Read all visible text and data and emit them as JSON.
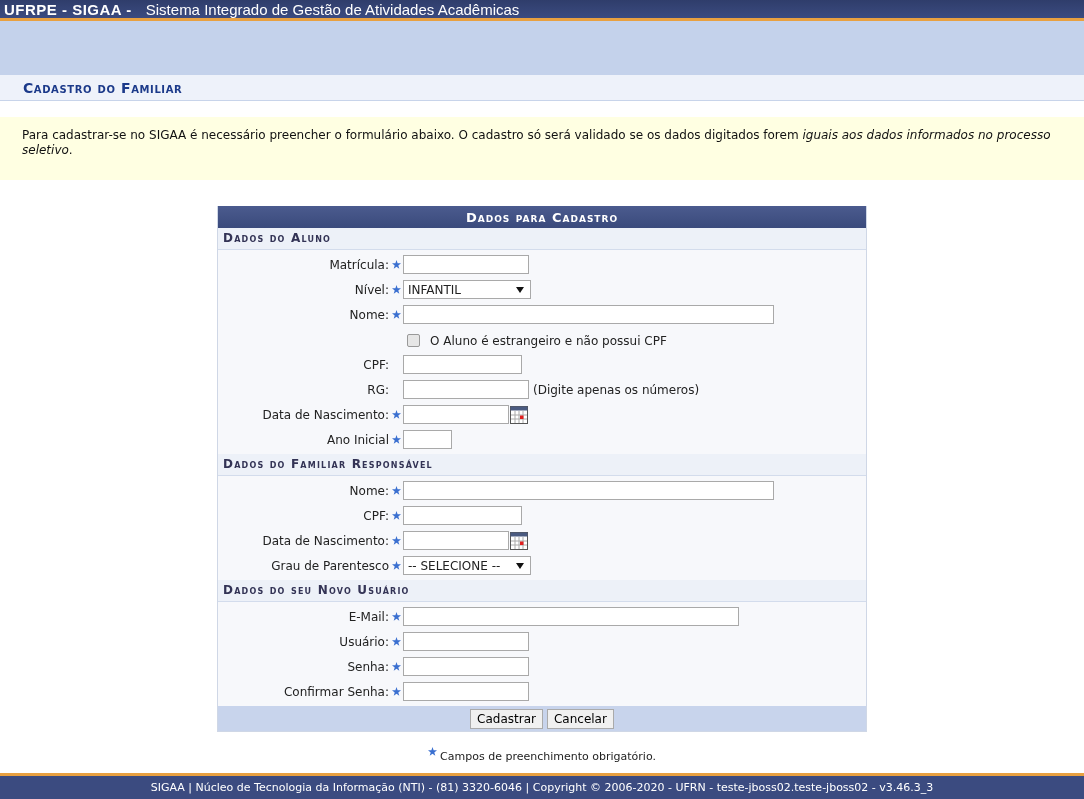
{
  "header": {
    "brand": "UFRPE - SIGAA -",
    "system_name": "Sistema Integrado de Gestão de Atividades Acadêmicas"
  },
  "page_title": "Cadastro do Familiar",
  "notice": "Para cadastrar-se no SIGAA é necessário preencher o formulário abaixo. O cadastro só será validado se os dados digitados forem *iguais aos dados informados no processo seletivo*.",
  "form": {
    "title": "Dados para Cadastro",
    "sections": [
      {
        "title": "Dados do Aluno",
        "fields": [
          {
            "kind": "medium",
            "label": "Matrícula:",
            "required": true
          },
          {
            "kind": "select",
            "label": "Nível:",
            "required": true,
            "value": "INFANTIL"
          },
          {
            "kind": "long",
            "label": "Nome:",
            "required": true
          },
          {
            "kind": "checkbox",
            "label": "O Aluno é estrangeiro e não possui CPF",
            "checked": false
          },
          {
            "kind": "short",
            "label": "CPF:",
            "required": false
          },
          {
            "kind": "medium",
            "label": "RG:",
            "required": false,
            "hint": "(Digite apenas os números)"
          },
          {
            "kind": "date",
            "label": "Data de Nascimento:",
            "required": true
          },
          {
            "kind": "tiny",
            "label": "Ano Inicial",
            "required": true
          }
        ]
      },
      {
        "title": "Dados do Familiar Responsável",
        "fields": [
          {
            "kind": "long",
            "label": "Nome:",
            "required": true
          },
          {
            "kind": "short",
            "label": "CPF:",
            "required": true
          },
          {
            "kind": "date",
            "label": "Data de Nascimento:",
            "required": true
          },
          {
            "kind": "select",
            "label": "Grau de Parentesco",
            "required": true,
            "value": "-- SELECIONE --"
          }
        ]
      },
      {
        "title": "Dados do seu Novo Usuário",
        "fields": [
          {
            "kind": "wide",
            "label": "E-Mail:",
            "required": true
          },
          {
            "kind": "medium",
            "label": "Usuário:",
            "required": true
          },
          {
            "kind": "medium",
            "label": "Senha:",
            "required": true
          },
          {
            "kind": "medium",
            "label": "Confirmar Senha:",
            "required": true
          }
        ]
      }
    ],
    "buttons": [
      "Cadastrar",
      "Cancelar"
    ]
  },
  "required_note": "Campos de preenchimento obrigatório.",
  "footer": "SIGAA | Núcleo de Tecnologia da Informação (NTI) - (81) 3320-6046 | Copyright © 2006-2020 - UFRN - teste-jboss02.teste-jboss02 - v3.46.3_3"
}
